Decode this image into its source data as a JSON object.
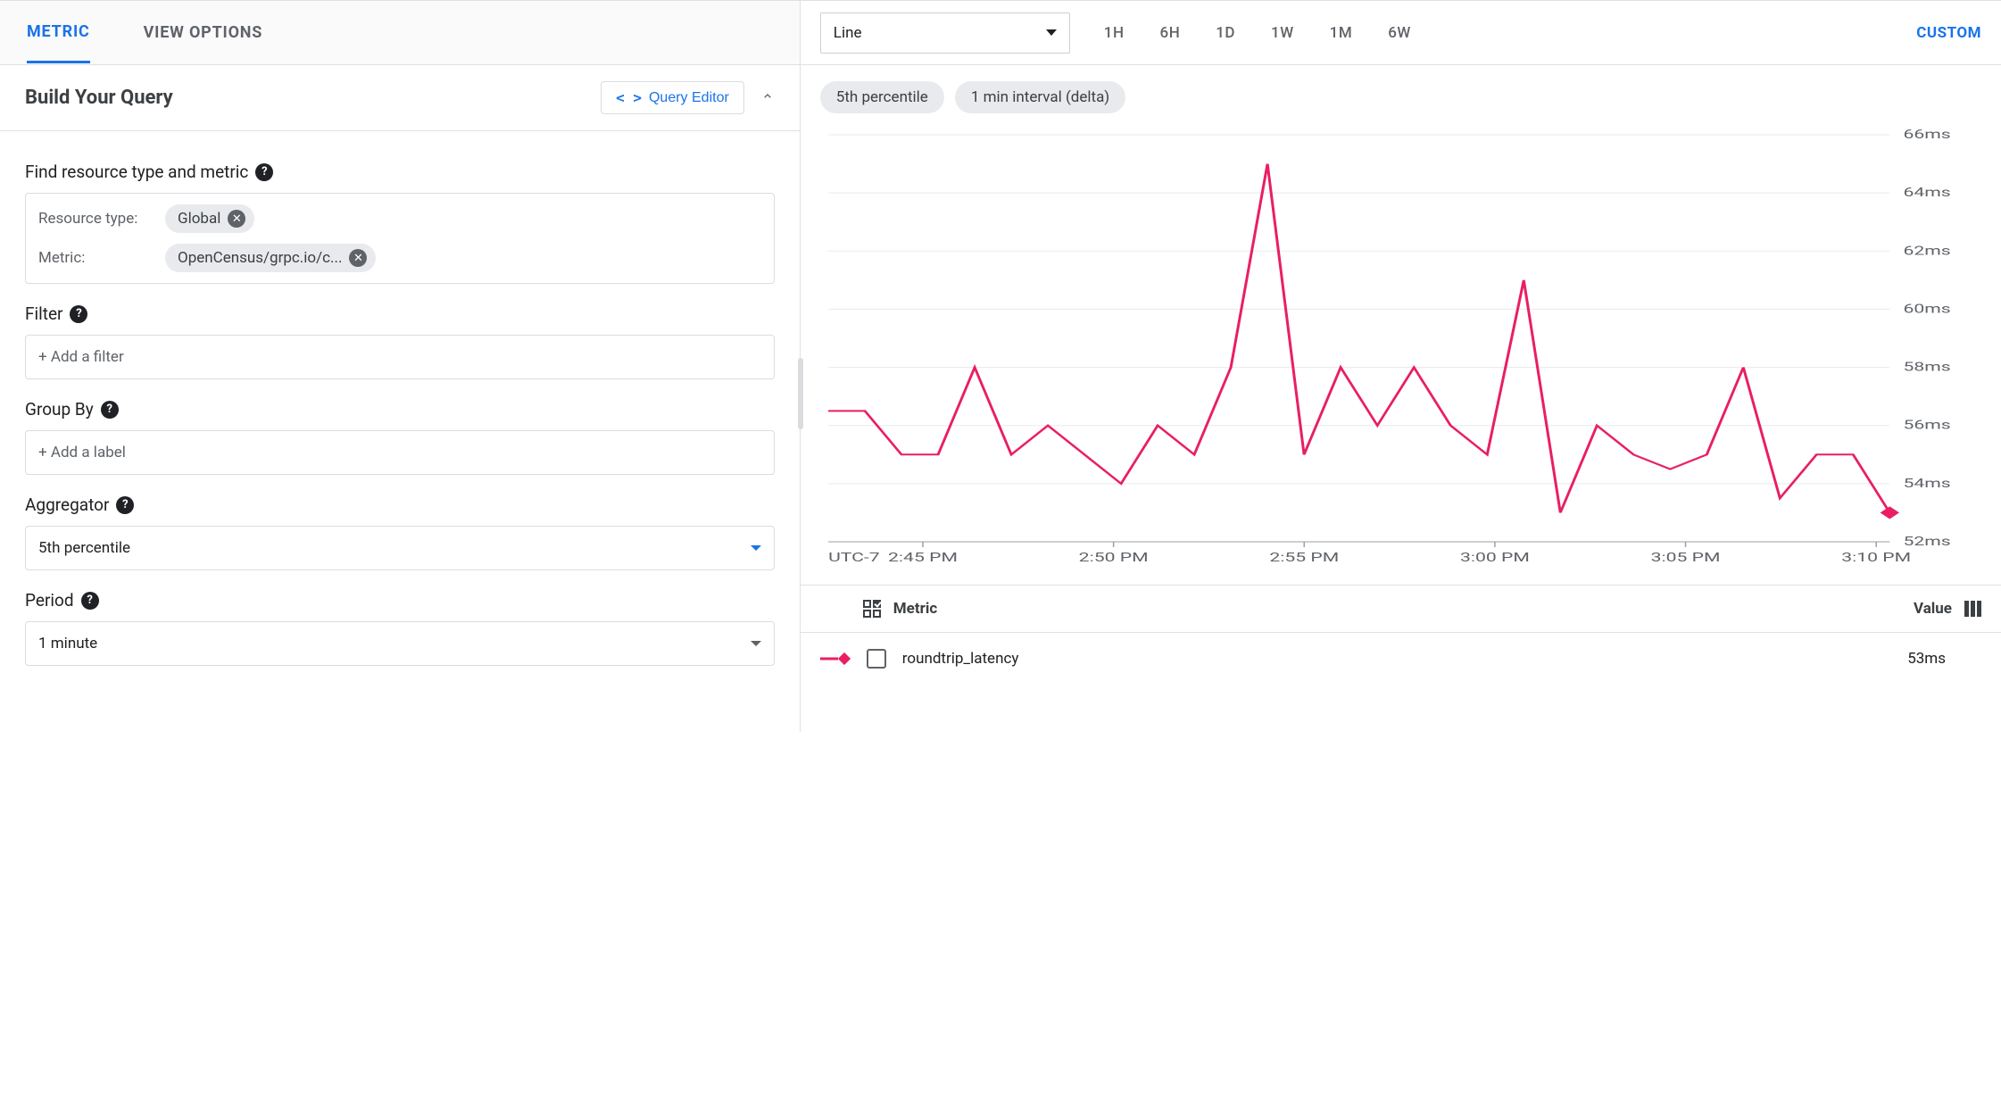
{
  "left": {
    "tabs": {
      "metric": "METRIC",
      "view_options": "VIEW OPTIONS"
    },
    "build_title": "Build Your Query",
    "query_editor_btn": "Query Editor",
    "find_label": "Find resource type and metric",
    "resource_type_label": "Resource type:",
    "resource_type_chip": "Global",
    "metric_row_label": "Metric:",
    "metric_chip": "OpenCensus/grpc.io/c...",
    "filter_label": "Filter",
    "filter_placeholder": "+ Add a filter",
    "groupby_label": "Group By",
    "groupby_placeholder": "+ Add a label",
    "aggregator_label": "Aggregator",
    "aggregator_value": "5th percentile",
    "period_label": "Period",
    "period_value": "1 minute"
  },
  "right": {
    "viz_type": "Line",
    "ranges": [
      "1H",
      "6H",
      "1D",
      "1W",
      "1M",
      "6W"
    ],
    "custom_range": "CUSTOM",
    "pills": [
      "5th percentile",
      "1 min interval (delta)"
    ],
    "legend_header_metric": "Metric",
    "legend_header_value": "Value",
    "legend_name": "roundtrip_latency",
    "legend_value": "53ms",
    "series_color": "#e91e63"
  },
  "chart_data": {
    "type": "line",
    "title": "",
    "x_timezone_label": "UTC-7",
    "xlabel": "",
    "ylabel": "",
    "ylim": [
      52,
      66
    ],
    "y_ticks": [
      "52ms",
      "54ms",
      "56ms",
      "58ms",
      "60ms",
      "62ms",
      "64ms",
      "66ms"
    ],
    "x_ticks": [
      "2:45 PM",
      "2:50 PM",
      "2:55 PM",
      "3:00 PM",
      "3:05 PM",
      "3:10 PM"
    ],
    "series": [
      {
        "name": "roundtrip_latency",
        "color": "#e91e63",
        "x": [
          "2:42",
          "2:43",
          "2:44",
          "2:45",
          "2:46",
          "2:47",
          "2:48",
          "2:49",
          "2:50",
          "2:51",
          "2:52",
          "2:53",
          "2:54",
          "2:55",
          "2:56",
          "2:57",
          "2:58",
          "2:59",
          "3:00",
          "3:01",
          "3:02",
          "3:03",
          "3:04",
          "3:05",
          "3:06",
          "3:07",
          "3:08",
          "3:09",
          "3:10",
          "3:11"
        ],
        "values": [
          56.5,
          56.5,
          55,
          55,
          58,
          55,
          56,
          55,
          54,
          56,
          55,
          58,
          65,
          55,
          58,
          56,
          58,
          56,
          55,
          61,
          53,
          56,
          55,
          54.5,
          55,
          58,
          53.5,
          55,
          55,
          53
        ]
      }
    ]
  }
}
